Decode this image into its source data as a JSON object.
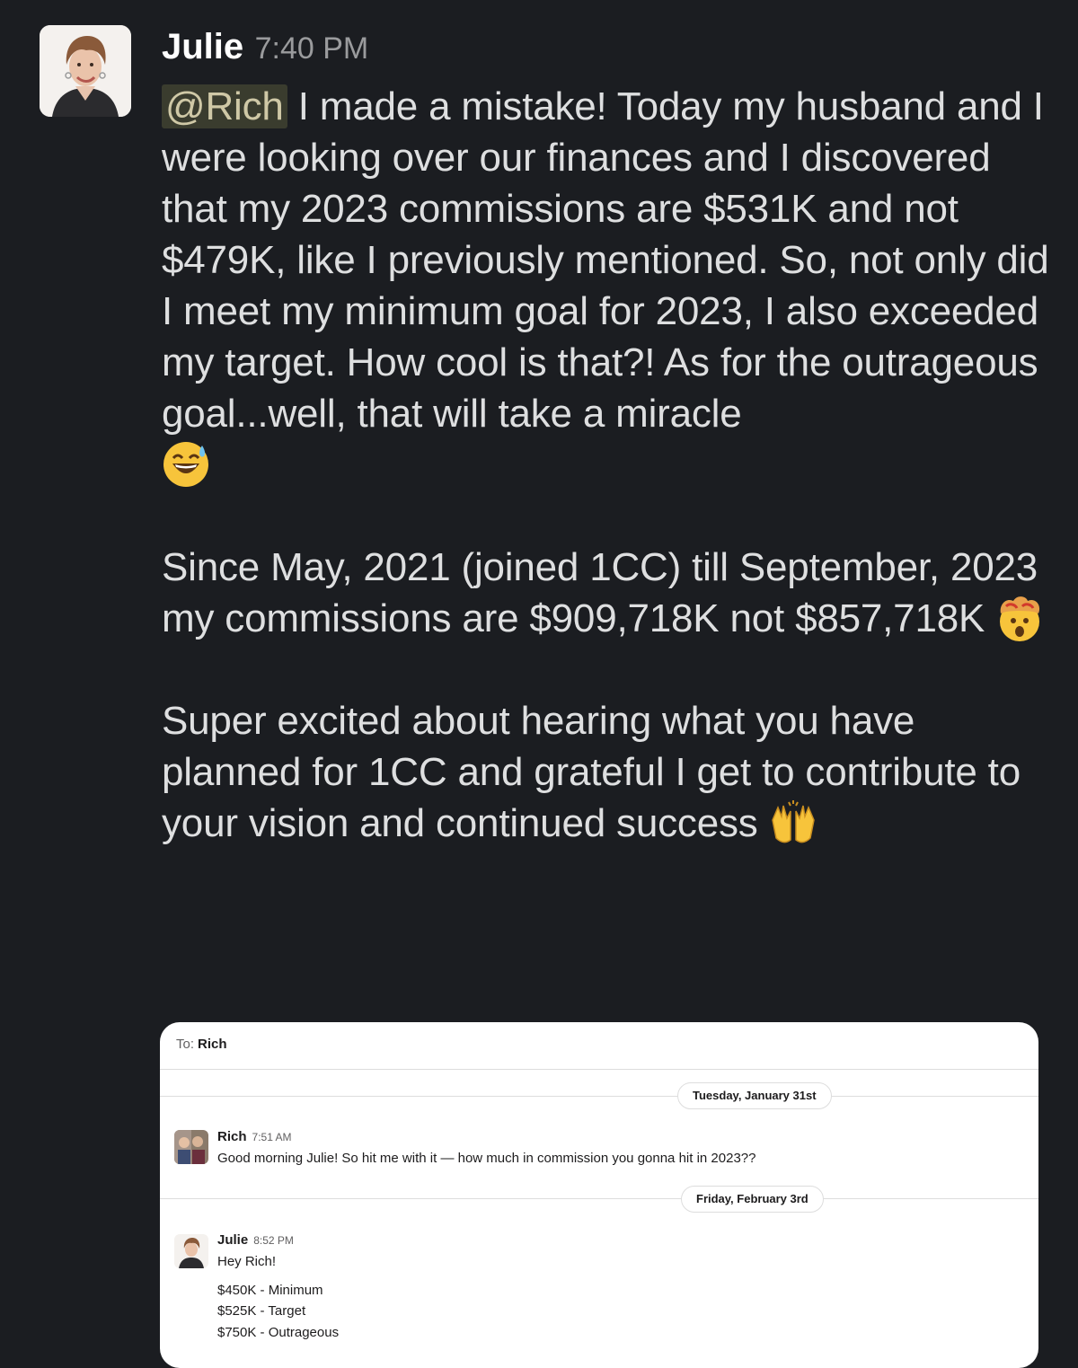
{
  "message": {
    "author": "Julie",
    "time": "7:40 PM",
    "mention": "@Rich",
    "para1_text": " I made a mistake! Today my husband and I were looking over our finances and I discovered that my 2023 commissions are $531K and not $479K, like I previously mentioned.  So, not only did I meet my minimum goal for 2023, I also exceeded my target.  How cool is that?!  As for the outrageous goal...well, that will take a miracle",
    "para1_emoji": "sweat-smile-emoji",
    "para2_text": "Since May, 2021 (joined 1CC) till September, 2023 my commissions are $909,718K not $857,718K",
    "para2_emoji": "exploding-head-emoji",
    "para3_text": "Super excited about hearing what you have planned for 1CC and grateful I get to contribute to your vision and continued success",
    "para3_emoji": "raising-hands-emoji"
  },
  "embed": {
    "to_label": "To:",
    "to_name": "Rich",
    "day1": "Tuesday, January 31st",
    "msg1": {
      "author": "Rich",
      "time": "7:51 AM",
      "text": "Good morning Julie! So hit me with it — how much in commission you gonna hit in 2023??"
    },
    "day2": "Friday, February 3rd",
    "msg2": {
      "author": "Julie",
      "time": "8:52 PM",
      "line1": "Hey Rich!",
      "line2": "$450K - Minimum",
      "line3": "$525K - Target",
      "line4": "$750K - Outrageous"
    }
  },
  "colors": {
    "background": "#1b1d21",
    "text": "#dedfe0",
    "mention_bg": "#3a3c2e",
    "embed_bg": "#ffffff"
  }
}
